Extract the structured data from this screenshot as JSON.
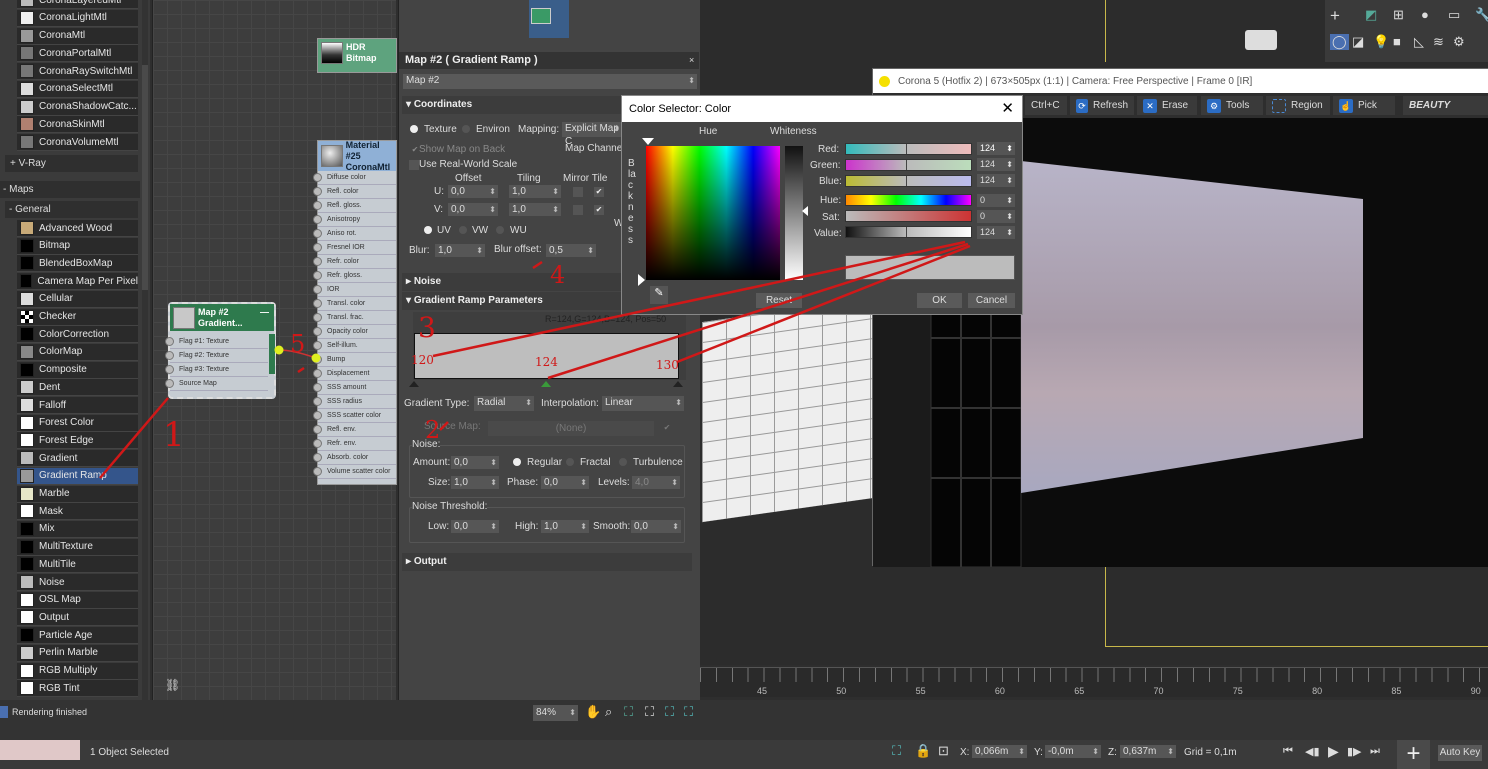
{
  "browser": {
    "materials": [
      {
        "label": "CoronaLayeredMtl",
        "swatch": "#bbbbbb"
      },
      {
        "label": "CoronaLightMtl",
        "swatch": "#eeeeee"
      },
      {
        "label": "CoronaMtl",
        "swatch": "#999999"
      },
      {
        "label": "CoronaPortalMtl",
        "swatch": "#777777"
      },
      {
        "label": "CoronaRaySwitchMtl",
        "swatch": "#777777"
      },
      {
        "label": "CoronaSelectMtl",
        "swatch": "#dddddd"
      },
      {
        "label": "CoronaShadowCatc...",
        "swatch": "#cccccc"
      },
      {
        "label": "CoronaSkinMtl",
        "swatch": "#b08070"
      },
      {
        "label": "CoronaVolumeMtl",
        "swatch": "#777777"
      }
    ],
    "vray_group": "+ V-Ray",
    "maps_group": "- Maps",
    "general_group": "- General",
    "maps": [
      {
        "label": "Advanced Wood",
        "swatch": "#c8aa78"
      },
      {
        "label": "Bitmap",
        "swatch": "#000000"
      },
      {
        "label": "BlendedBoxMap",
        "swatch": "#000000"
      },
      {
        "label": "Camera Map Per Pixel",
        "swatch": "#000000"
      },
      {
        "label": "Cellular",
        "swatch": "#dddddd"
      },
      {
        "label": "Checker",
        "swatch": "checker"
      },
      {
        "label": "ColorCorrection",
        "swatch": "#000000"
      },
      {
        "label": "ColorMap",
        "swatch": "#888888"
      },
      {
        "label": "Composite",
        "swatch": "#000000"
      },
      {
        "label": "Dent",
        "swatch": "#cccccc"
      },
      {
        "label": "Falloff",
        "swatch": "#dddddd"
      },
      {
        "label": "Forest Color",
        "swatch": "#ffffff"
      },
      {
        "label": "Forest Edge",
        "swatch": "#ffffff"
      },
      {
        "label": "Gradient",
        "swatch": "#bbbbbb"
      },
      {
        "label": "Gradient Ramp",
        "swatch": "#999999",
        "selected": true
      },
      {
        "label": "Marble",
        "swatch": "#e6e6c8"
      },
      {
        "label": "Mask",
        "swatch": "#ffffff"
      },
      {
        "label": "Mix",
        "swatch": "#000000"
      },
      {
        "label": "MultiTexture",
        "swatch": "#000000"
      },
      {
        "label": "MultiTile",
        "swatch": "#000000"
      },
      {
        "label": "Noise",
        "swatch": "#bbbbbb"
      },
      {
        "label": "OSL Map",
        "swatch": "#ffffff"
      },
      {
        "label": "Output",
        "swatch": "#ffffff"
      },
      {
        "label": "Particle Age",
        "swatch": "#000000"
      },
      {
        "label": "Perlin Marble",
        "swatch": "#cccccc"
      },
      {
        "label": "RGB Multiply",
        "swatch": "#ffffff"
      },
      {
        "label": "RGB Tint",
        "swatch": "#ffffff"
      }
    ]
  },
  "nodes": {
    "hdr": {
      "line1": "HDR",
      "line2": "Bitmap"
    },
    "material": {
      "line1": "Material #25",
      "line2": "CoronaMtl",
      "slots": [
        "Diffuse color",
        "Refl. color",
        "Refl. gloss.",
        "Anisotropy",
        "Aniso rot.",
        "Fresnel IOR",
        "Refr. color",
        "Refr. gloss.",
        "IOR",
        "Transl. color",
        "Transl. frac.",
        "Opacity color",
        "Self-illum.",
        "Bump",
        "Displacement",
        "SSS amount",
        "SSS radius",
        "SSS scatter color",
        "Refl. env.",
        "Refr. env.",
        "Absorb. color",
        "Volume scatter color"
      ]
    },
    "map": {
      "line1": "Map #2",
      "line2": "Gradient...",
      "slots": [
        "Flag #1: Texture",
        "Flag #2: Texture",
        "Flag #3: Texture",
        "Source Map"
      ]
    }
  },
  "params": {
    "title": "Map #2  ( Gradient Ramp )",
    "name_value": "Map #2",
    "coordinates": "Coordinates",
    "texture": "Texture",
    "environ": "Environ",
    "mapping_label": "Mapping:",
    "mapping_value": "Explicit Map C",
    "show_map_on_back": "Show Map on Back",
    "map_channel": "Map Channel",
    "real_world": "Use Real-World Scale",
    "offset": "Offset",
    "tiling": "Tiling",
    "mirror_tile": "Mirror Tile",
    "u_label": "U:",
    "v_label": "V:",
    "w_label": "W",
    "u_offset": "0,0",
    "v_offset": "0,0",
    "u_tiling": "1,0",
    "v_tiling": "1,0",
    "uv": "UV",
    "vw": "VW",
    "wu": "WU",
    "blur_label": "Blur:",
    "blur": "1,0",
    "blur_offset_label": "Blur offset:",
    "blur_offset": "0,5",
    "noise_rollout": "Noise",
    "gradient_rollout": "Gradient Ramp Parameters",
    "flag_info": "R=124,G=124,B=124, Pos=50",
    "ramp_color": "#bebebe",
    "active_flag_color": "#3a9a3a",
    "gradient_type_label": "Gradient Type:",
    "gradient_type": "Radial",
    "interpolation_label": "Interpolation:",
    "interpolation": "Linear",
    "source_map_label": "Source Map:",
    "source_map": "(None)",
    "noise_group": "Noise:",
    "amount_label": "Amount:",
    "amount": "0,0",
    "regular": "Regular",
    "fractal": "Fractal",
    "turbulence": "Turbulence",
    "size_label": "Size:",
    "size": "1,0",
    "phase_label": "Phase:",
    "phase": "0,0",
    "levels_label": "Levels:",
    "levels": "4,0",
    "threshold_group": "Noise Threshold:",
    "low_label": "Low:",
    "low": "0,0",
    "high_label": "High:",
    "high": "1,0",
    "smooth_label": "Smooth:",
    "smooth": "0,0",
    "output_rollout": "Output"
  },
  "corona": {
    "title": "Corona 5 (Hotfix 2) | 673×505px (1:1) | Camera: Free Perspective | Frame 0 [IR]",
    "ctrlc": "Ctrl+C",
    "refresh": "Refresh",
    "erase": "Erase",
    "tools": "Tools",
    "region": "Region",
    "pick": "Pick",
    "beauty": "BEAUTY"
  },
  "color_selector": {
    "title": "Color Selector: Color",
    "hue": "Hue",
    "whiteness": "Whiteness",
    "blackness": "Blackness",
    "red_label": "Red:",
    "green_label": "Green:",
    "blue_label": "Blue:",
    "hue_label": "Hue:",
    "sat_label": "Sat:",
    "value_label": "Value:",
    "red": "124",
    "green": "124",
    "blue": "124",
    "hue_value": "0",
    "sat": "0",
    "value": "124",
    "preview_color": "#bcbcbc",
    "reset": "Reset",
    "ok": "OK",
    "cancel": "Cancel"
  },
  "timeline": {
    "ticks": [
      "45",
      "50",
      "55",
      "60",
      "65",
      "70",
      "75",
      "80",
      "85",
      "90"
    ]
  },
  "status": {
    "rendering": "Rendering finished",
    "zoom": "84%",
    "selected": "1 Object Selected",
    "x_label": "X:",
    "x": "0,066m",
    "y_label": "Y:",
    "y": "-0,0m",
    "z_label": "Z:",
    "z": "0,637m",
    "grid": "Grid = 0,1m",
    "auto_key": "Auto Key"
  },
  "annotations": {
    "n1": "1",
    "n2": "2",
    "n3": "3",
    "n4": "4",
    "n5": "5",
    "v120": "120",
    "v124": "124",
    "v130": "130",
    "color": "#d01818"
  }
}
